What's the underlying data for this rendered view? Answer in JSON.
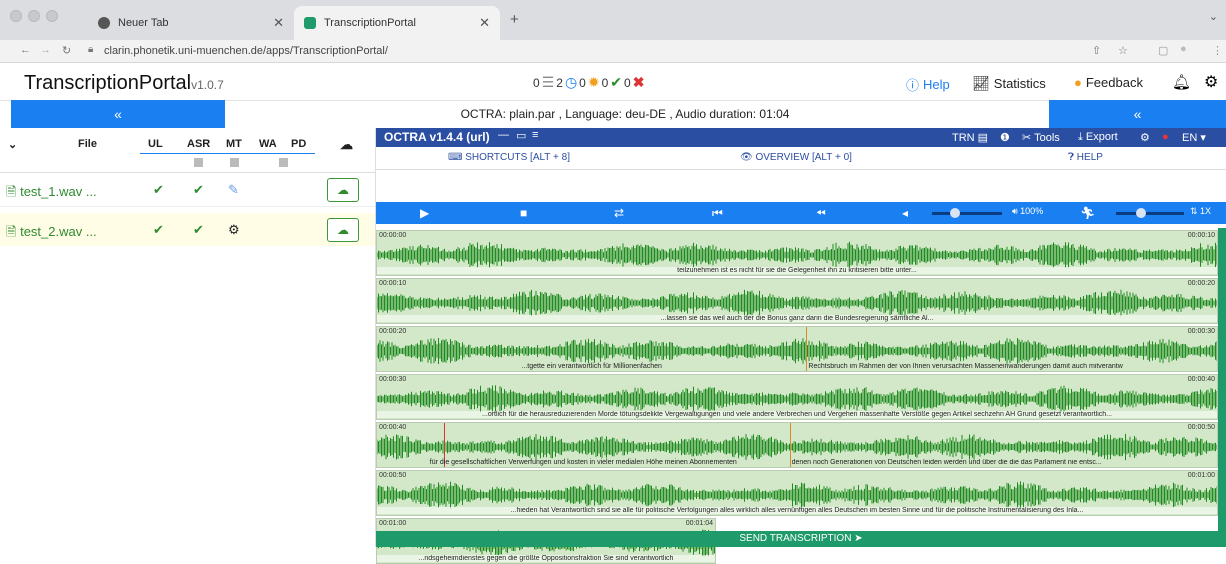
{
  "browser": {
    "tabs": [
      {
        "label": "Neuer Tab"
      },
      {
        "label": "TranscriptionPortal"
      }
    ],
    "url": "clarin.phonetik.uni-muenchen.de/apps/TranscriptionPortal/"
  },
  "app": {
    "title": "TranscriptionPortal",
    "version": "v1.0.7",
    "status": {
      "queued": "0",
      "waiting": "2",
      "processing": "0",
      "done": "0",
      "failed": "0"
    },
    "help_label": "Help",
    "statistics_label": "Statistics",
    "feedback_label": "Feedback"
  },
  "bluebar": {
    "left_button": "«",
    "right_button": "«",
    "info": "OCTRA: plain.par , Language: deu-DE , Audio duration: 01:04"
  },
  "table": {
    "headers": {
      "file": "File",
      "ul": "UL",
      "asr": "ASR",
      "mt": "MT",
      "wa": "WA",
      "pd": "PD"
    },
    "rows": [
      {
        "file": "test_1.wav ..."
      },
      {
        "file": "test_2.wav ..."
      }
    ]
  },
  "octra": {
    "title": "OCTRA v1.4.4 (url)",
    "trn": "TRN",
    "tools": "Tools",
    "export": "Export",
    "lang": "EN",
    "shortcuts": "SHORTCUTS [ALT + 8]",
    "overview": "OVERVIEW [ALT + 0]",
    "help": "HELP",
    "volume": "100%",
    "speed": "1X",
    "send": "SEND TRANSCRIPTION"
  },
  "waveform": {
    "lines": [
      {
        "start": "00:00:00",
        "end": "00:00:10",
        "text": "teilzunehmen ist es nicht für sie die Gelegenheit ihn zu kritisieren bitte unter..."
      },
      {
        "start": "00:00:10",
        "end": "00:00:20",
        "text": "...lassen sie das weil auch der die Bonus ganz darin die Bundesregierung sämtliche Al..."
      },
      {
        "start": "00:00:20",
        "end": "00:00:30",
        "text": "...tgette ein verantwortlich für Millionenfachen",
        "text2": "Rechtsbruch im Rahmen der von Ihnen verursachten Masseneinwanderungen damit auch mitverantw"
      },
      {
        "start": "00:00:30",
        "end": "00:00:40",
        "text": "...ortlich für die herausreduzierenden Morde tötungsdelikte Vergewaltigungen und viele andere Verbrechen und Vergehen massenhafte Verstöße gegen Artikel sechzehn AH Grund gesetzt verantwortlich..."
      },
      {
        "start": "00:00:40",
        "end": "00:00:50",
        "text": "für die gesellschaftlichen Verwerfungen und kosten in vieler medialen Höhe meinen Abonnementen",
        "text2": "denen noch Generationen von Deutschen leiden werden und über die die das Parlament nie entsc..."
      },
      {
        "start": "00:00:50",
        "end": "00:01:00",
        "text": "...hieden hat Verantwortlich sind sie alle für politische Verfolgungen alles wirklich alles vernünftigen alles Deutschen im besten Sinne und für die politische Instrumentalisierung des Inla..."
      },
      {
        "start": "00:01:00",
        "end": "00:01:04",
        "text": "...ndsgeheimdienstes gegen die größte Oppositionsfraktion Sie sind verantwortlich"
      }
    ]
  },
  "colors": {
    "accent": "#1a7ff0",
    "octra": "#2a4ea1",
    "wave": "#1f8a1f",
    "send": "#1f9a6b"
  }
}
